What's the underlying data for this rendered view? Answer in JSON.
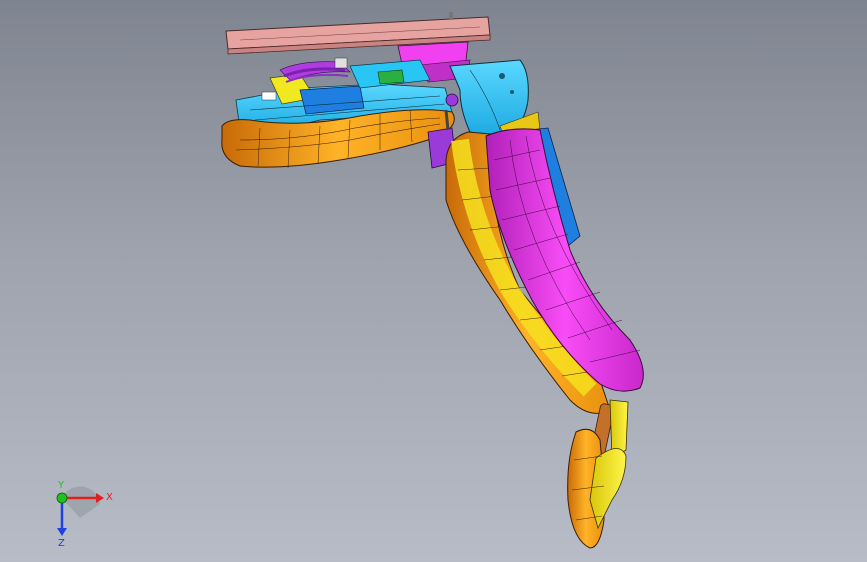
{
  "viewport": {
    "background_top": "#7f8590",
    "background_bottom": "#b7bcc7"
  },
  "model": {
    "colors": {
      "plate": "#e7a3a0",
      "magenta": "#f23df2",
      "orange": "#ffab1a",
      "yellow": "#f6f01e",
      "cyan": "#27c6f5",
      "blue": "#1e7fe0",
      "purple": "#a23ce0",
      "mesh_line": "#2a1a10"
    }
  },
  "triad": {
    "x_label": "X",
    "y_label": "Y",
    "z_label": "Z",
    "x_color": "#e02020",
    "y_color": "#20c020",
    "z_color": "#2040e0"
  }
}
